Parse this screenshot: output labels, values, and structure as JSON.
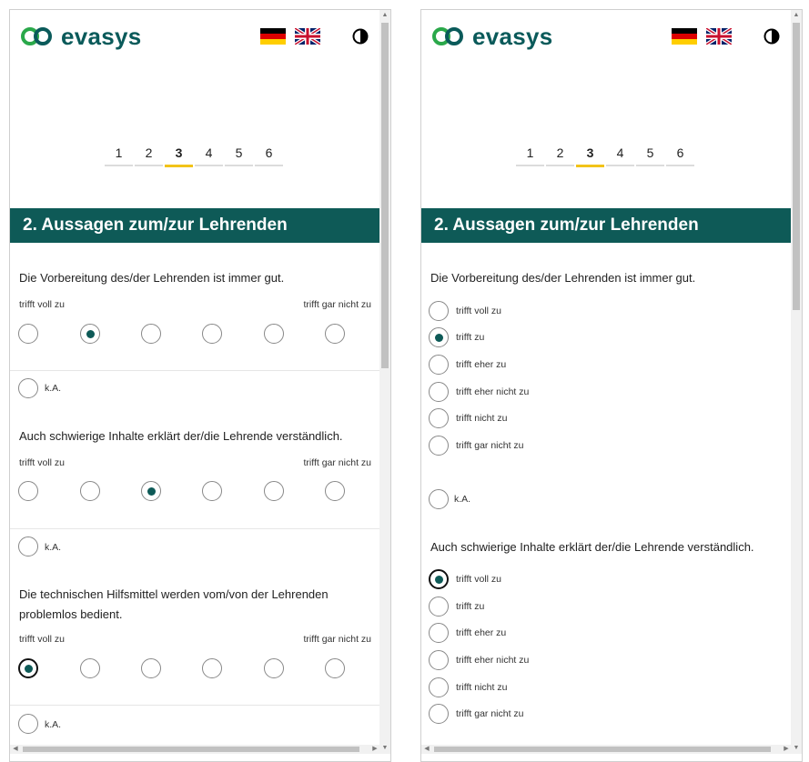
{
  "header": {
    "logo_text": "evasys",
    "logo_icon": "evasys-logo-icon",
    "flags": [
      "german-flag-icon",
      "uk-flag-icon"
    ],
    "contrast_icon": "contrast-icon"
  },
  "steps": {
    "items": [
      "1",
      "2",
      "3",
      "4",
      "5",
      "6"
    ],
    "active": "3"
  },
  "section": {
    "title": "2. Aussagen zum/zur Lehrenden"
  },
  "scale": {
    "left": "trifft voll zu",
    "right": "trifft gar nicht zu",
    "na": "k.A."
  },
  "questions": [
    {
      "text": "Die Vorbereitung des/der Lehrenden ist immer gut.",
      "selected_index": 1
    },
    {
      "text": "Auch schwierige Inhalte erklärt der/die Lehrende verständlich.",
      "selected_index": 2
    },
    {
      "text": "Die technischen Hilfsmittel werden vom/von der Lehrenden problemlos bedient.",
      "selected_index": 0
    }
  ],
  "options": [
    "trifft voll zu",
    "trifft zu",
    "trifft eher zu",
    "trifft eher nicht zu",
    "trifft nicht zu",
    "trifft gar nicht zu"
  ],
  "right_panel": {
    "q1_selected": "trifft zu",
    "q2_selected": "trifft voll zu"
  },
  "colors": {
    "brand_teal": "#0e5a57",
    "active_step": "#f2c318"
  }
}
